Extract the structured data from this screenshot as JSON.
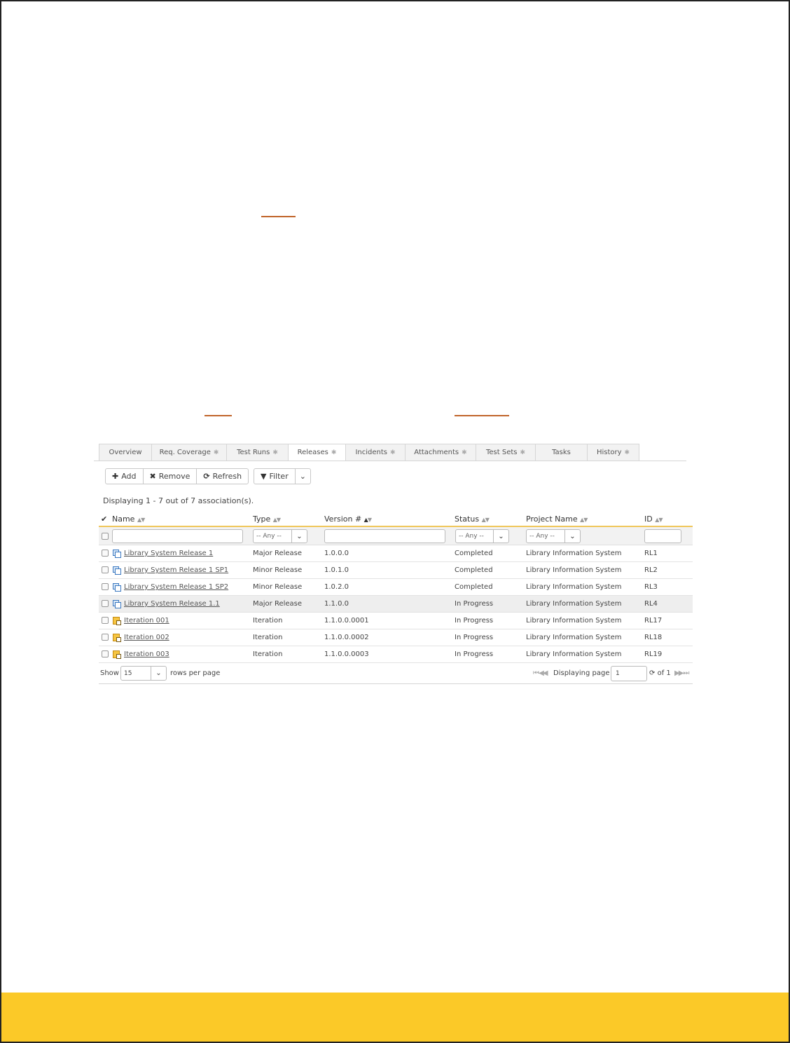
{
  "tabs": [
    {
      "label": "Overview",
      "star": false
    },
    {
      "label": "Req. Coverage",
      "star": true
    },
    {
      "label": "Test Runs",
      "star": true
    },
    {
      "label": "Releases",
      "star": true,
      "active": true
    },
    {
      "label": "Incidents",
      "star": true
    },
    {
      "label": "Attachments",
      "star": true
    },
    {
      "label": "Test Sets",
      "star": true
    },
    {
      "label": "Tasks",
      "star": false
    },
    {
      "label": "History",
      "star": true
    }
  ],
  "toolbar": {
    "add_label": "Add",
    "remove_label": "Remove",
    "refresh_label": "Refresh",
    "filter_label": "Filter"
  },
  "display_count": "Displaying 1 - 7 out of 7 association(s).",
  "columns": {
    "name": "Name",
    "type": "Type",
    "version": "Version #",
    "status": "Status",
    "project": "Project Name",
    "id": "ID"
  },
  "filters": {
    "type_any": "-- Any --",
    "status_any": "-- Any --",
    "project_any": "-- Any --"
  },
  "rows": [
    {
      "name": "Library System Release 1",
      "type": "Major Release",
      "version": "1.0.0.0",
      "status": "Completed",
      "project": "Library Information System",
      "id": "RL1",
      "kind": "release"
    },
    {
      "name": "Library System Release 1 SP1",
      "type": "Minor Release",
      "version": "1.0.1.0",
      "status": "Completed",
      "project": "Library Information System",
      "id": "RL2",
      "kind": "release"
    },
    {
      "name": "Library System Release 1 SP2",
      "type": "Minor Release",
      "version": "1.0.2.0",
      "status": "Completed",
      "project": "Library Information System",
      "id": "RL3",
      "kind": "release"
    },
    {
      "name": "Library System Release 1.1",
      "type": "Major Release",
      "version": "1.1.0.0",
      "status": "In Progress",
      "project": "Library Information System",
      "id": "RL4",
      "kind": "release"
    },
    {
      "name": "Iteration 001",
      "type": "Iteration",
      "version": "1.1.0.0.0001",
      "status": "In Progress",
      "project": "Library Information System",
      "id": "RL17",
      "kind": "iteration"
    },
    {
      "name": "Iteration 002",
      "type": "Iteration",
      "version": "1.1.0.0.0002",
      "status": "In Progress",
      "project": "Library Information System",
      "id": "RL18",
      "kind": "iteration"
    },
    {
      "name": "Iteration 003",
      "type": "Iteration",
      "version": "1.1.0.0.0003",
      "status": "In Progress",
      "project": "Library Information System",
      "id": "RL19",
      "kind": "iteration"
    }
  ],
  "pager": {
    "show_label": "Show",
    "rows_value": "15",
    "rows_per_page_label": "rows per page",
    "displaying_page_label": "Displaying page",
    "page_value": "1",
    "of_label": "of 1"
  },
  "colors": {
    "footer": "#fbc928",
    "accent_underline": "#c0642a",
    "header_border": "#f0c75a"
  }
}
